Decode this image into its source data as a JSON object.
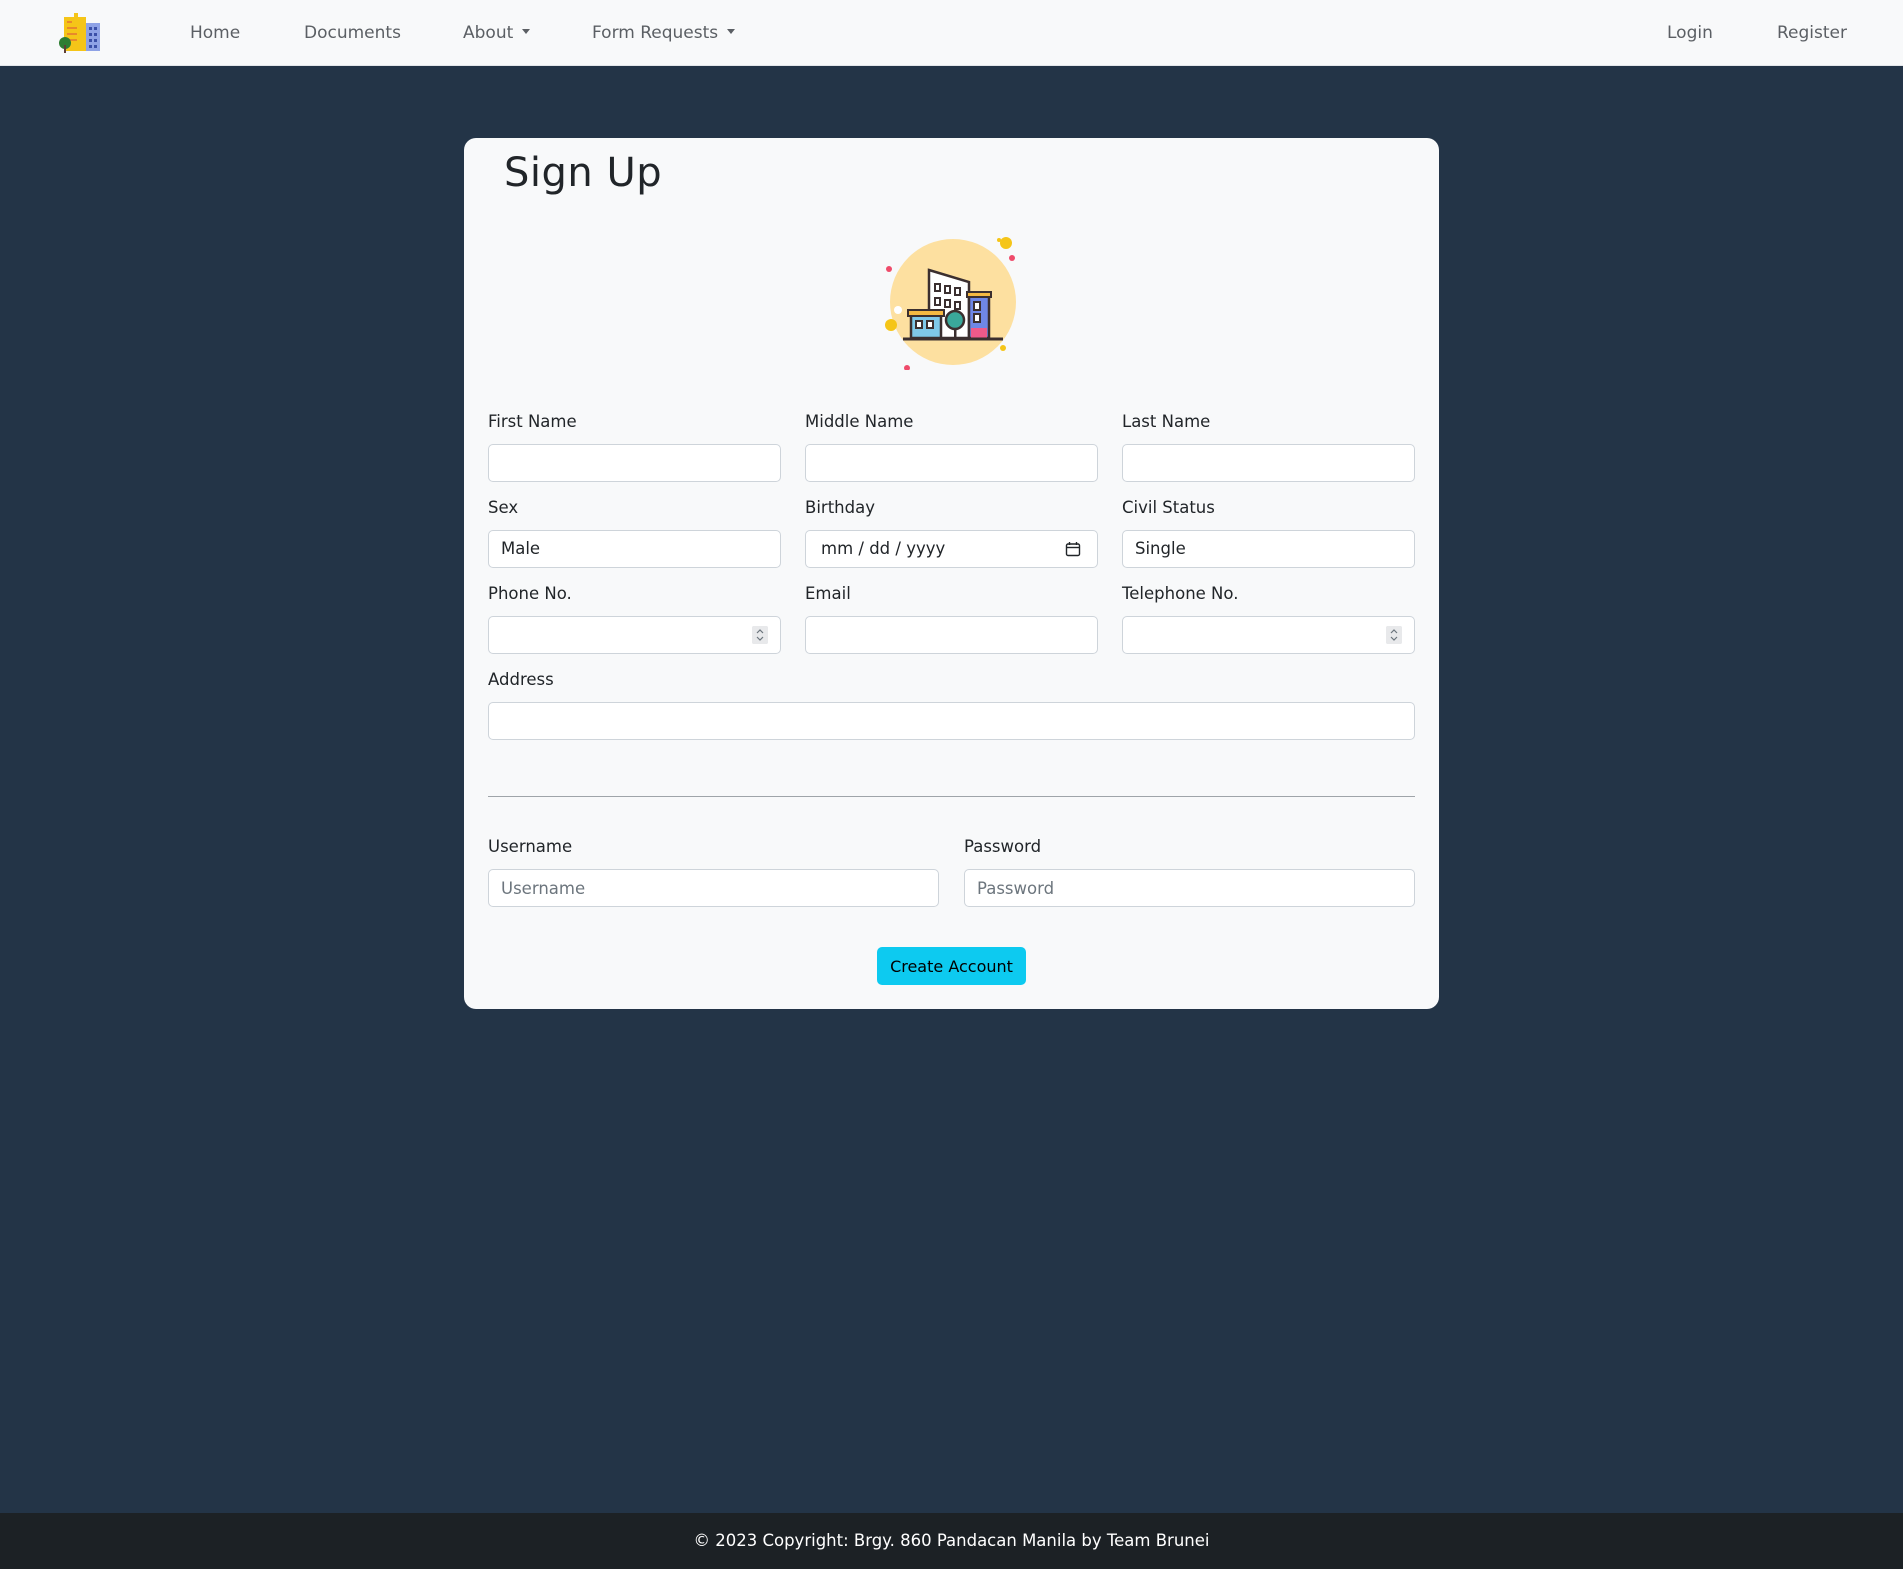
{
  "navbar": {
    "logo_icon": "city-buildings-logo-icon",
    "items": [
      {
        "label": "Home"
      },
      {
        "label": "Documents"
      },
      {
        "label": "About",
        "dropdown": true
      },
      {
        "label": "Form Requests",
        "dropdown": true
      }
    ],
    "right_items": [
      {
        "label": "Login"
      },
      {
        "label": "Register"
      }
    ]
  },
  "signup": {
    "title": "Sign Up",
    "hero_icon": "city-buildings-illustration-icon",
    "fields": {
      "first_name": {
        "label": "First Name",
        "value": ""
      },
      "middle_name": {
        "label": "Middle Name",
        "value": ""
      },
      "last_name": {
        "label": "Last Name",
        "value": ""
      },
      "sex": {
        "label": "Sex",
        "value": "Male"
      },
      "birthday": {
        "label": "Birthday",
        "placeholder": "mm / dd / yyyy"
      },
      "civil_status": {
        "label": "Civil Status",
        "value": "Single"
      },
      "phone": {
        "label": "Phone No.",
        "value": ""
      },
      "email": {
        "label": "Email",
        "value": ""
      },
      "telephone": {
        "label": "Telephone No.",
        "value": ""
      },
      "address": {
        "label": "Address",
        "value": ""
      },
      "username": {
        "label": "Username",
        "placeholder": "Username"
      },
      "password": {
        "label": "Password",
        "placeholder": "Password"
      }
    },
    "submit_label": "Create Account"
  },
  "footer": {
    "text": "© 2023 Copyright: Brgy. 860 Pandacan Manila by Team Brunei"
  },
  "colors": {
    "navbar_bg": "#f8f9fa",
    "page_bg": "#233447",
    "card_bg": "#f8f9fa",
    "button_bg": "#0dcaf0",
    "footer_bg": "#1c2125"
  }
}
